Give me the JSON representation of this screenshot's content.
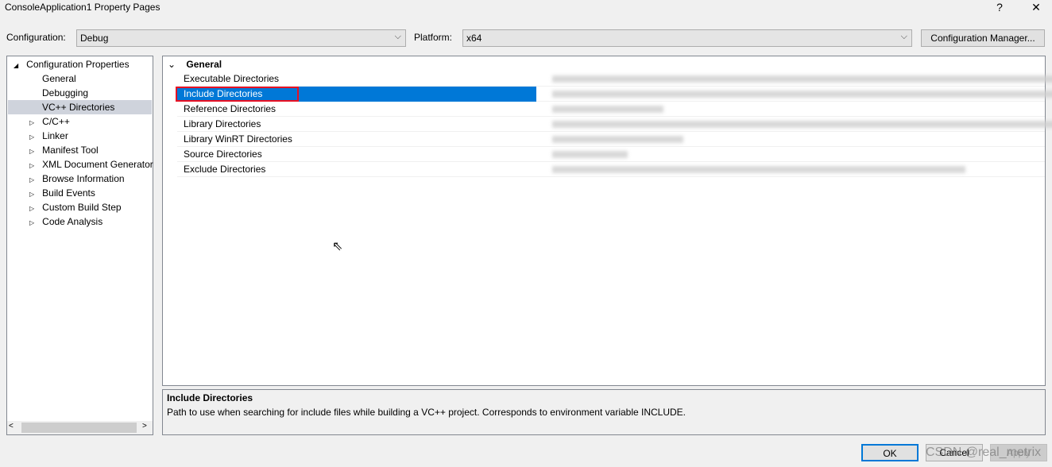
{
  "window": {
    "title": "ConsoleApplication1 Property Pages",
    "help": "?",
    "close": "✕"
  },
  "toolbar": {
    "configuration_label": "Configuration:",
    "configuration_value": "Debug",
    "platform_label": "Platform:",
    "platform_value": "x64",
    "config_manager": "Configuration Manager..."
  },
  "tree": {
    "root": "Configuration Properties",
    "items": [
      {
        "label": "General",
        "expandable": false
      },
      {
        "label": "Debugging",
        "expandable": false
      },
      {
        "label": "VC++ Directories",
        "expandable": false,
        "selected": true
      },
      {
        "label": "C/C++",
        "expandable": true
      },
      {
        "label": "Linker",
        "expandable": true
      },
      {
        "label": "Manifest Tool",
        "expandable": true
      },
      {
        "label": "XML Document Generator",
        "expandable": true
      },
      {
        "label": "Browse Information",
        "expandable": true
      },
      {
        "label": "Build Events",
        "expandable": true
      },
      {
        "label": "Custom Build Step",
        "expandable": true
      },
      {
        "label": "Code Analysis",
        "expandable": true
      }
    ]
  },
  "grid": {
    "section": "General",
    "rows": [
      {
        "name": "Executable Directories"
      },
      {
        "name": "Include Directories",
        "selected": true
      },
      {
        "name": "Reference Directories"
      },
      {
        "name": "Library Directories"
      },
      {
        "name": "Library WinRT Directories"
      },
      {
        "name": "Source Directories"
      },
      {
        "name": "Exclude Directories"
      }
    ]
  },
  "description": {
    "title": "Include Directories",
    "text": "Path to use when searching for include files while building a VC++ project.  Corresponds to environment variable INCLUDE."
  },
  "buttons": {
    "ok": "OK",
    "cancel": "Cancel",
    "apply": "Apply"
  },
  "watermark": "CSDN @real_metrix",
  "colors": {
    "selection": "#0078d7",
    "highlight_box": "#e81123"
  }
}
